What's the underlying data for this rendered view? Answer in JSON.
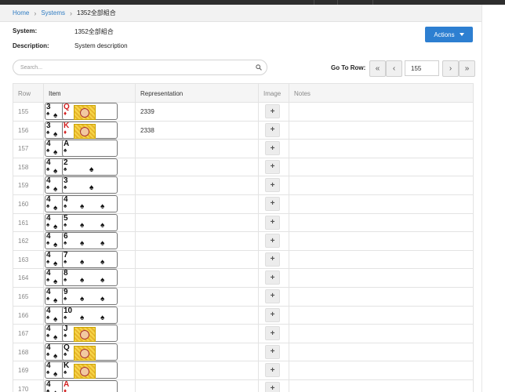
{
  "breadcrumb": {
    "home": "Home",
    "systems": "Systems",
    "current": "1352全部組合"
  },
  "meta": {
    "system_label": "System:",
    "system_value": "1352全部組合",
    "description_label": "Description:",
    "description_value": "System description"
  },
  "actions_label": "Actions",
  "search": {
    "placeholder": "Search..."
  },
  "goto": {
    "label": "Go To Row:",
    "value": "155"
  },
  "table": {
    "headers": {
      "row": "Row",
      "item": "Item",
      "representation": "Representation",
      "image": "Image",
      "notes": "Notes"
    }
  },
  "rows": [
    {
      "row": "155",
      "representation": "2339",
      "cards": [
        {
          "rank": "3",
          "suit": "♠"
        },
        {
          "rank": "Q",
          "suit": "♦",
          "face": true
        }
      ]
    },
    {
      "row": "156",
      "representation": "2338",
      "cards": [
        {
          "rank": "3",
          "suit": "♠"
        },
        {
          "rank": "K",
          "suit": "♦",
          "face": true
        }
      ]
    },
    {
      "row": "157",
      "representation": "",
      "cards": [
        {
          "rank": "4",
          "suit": "♠"
        },
        {
          "rank": "A",
          "suit": "♠"
        }
      ]
    },
    {
      "row": "158",
      "representation": "",
      "cards": [
        {
          "rank": "4",
          "suit": "♠"
        },
        {
          "rank": "2",
          "suit": "♠"
        }
      ]
    },
    {
      "row": "159",
      "representation": "",
      "cards": [
        {
          "rank": "4",
          "suit": "♠"
        },
        {
          "rank": "3",
          "suit": "♠"
        }
      ]
    },
    {
      "row": "160",
      "representation": "",
      "cards": [
        {
          "rank": "4",
          "suit": "♠"
        },
        {
          "rank": "4",
          "suit": "♠"
        }
      ]
    },
    {
      "row": "161",
      "representation": "",
      "cards": [
        {
          "rank": "4",
          "suit": "♠"
        },
        {
          "rank": "5",
          "suit": "♠"
        }
      ]
    },
    {
      "row": "162",
      "representation": "",
      "cards": [
        {
          "rank": "4",
          "suit": "♠"
        },
        {
          "rank": "6",
          "suit": "♠"
        }
      ]
    },
    {
      "row": "163",
      "representation": "",
      "cards": [
        {
          "rank": "4",
          "suit": "♠"
        },
        {
          "rank": "7",
          "suit": "♠"
        }
      ]
    },
    {
      "row": "164",
      "representation": "",
      "cards": [
        {
          "rank": "4",
          "suit": "♠"
        },
        {
          "rank": "8",
          "suit": "♠"
        }
      ]
    },
    {
      "row": "165",
      "representation": "",
      "cards": [
        {
          "rank": "4",
          "suit": "♠"
        },
        {
          "rank": "9",
          "suit": "♠"
        }
      ]
    },
    {
      "row": "166",
      "representation": "",
      "cards": [
        {
          "rank": "4",
          "suit": "♠"
        },
        {
          "rank": "10",
          "suit": "♠"
        }
      ]
    },
    {
      "row": "167",
      "representation": "",
      "cards": [
        {
          "rank": "4",
          "suit": "♠"
        },
        {
          "rank": "J",
          "suit": "♠",
          "face": true
        }
      ]
    },
    {
      "row": "168",
      "representation": "",
      "cards": [
        {
          "rank": "4",
          "suit": "♠"
        },
        {
          "rank": "Q",
          "suit": "♠",
          "face": true
        }
      ]
    },
    {
      "row": "169",
      "representation": "",
      "cards": [
        {
          "rank": "4",
          "suit": "♠"
        },
        {
          "rank": "K",
          "suit": "♠",
          "face": true
        }
      ]
    },
    {
      "row": "170",
      "representation": "",
      "cards": [
        {
          "rank": "4",
          "suit": "♠"
        },
        {
          "rank": "A",
          "suit": "♦"
        }
      ]
    }
  ],
  "icons": {
    "breadcrumb_separator": "chevron-right-icon",
    "actions_caret": "caret-down-icon",
    "search": "search-icon",
    "first": "double-chevron-left-icon",
    "prev": "chevron-left-icon",
    "next": "chevron-right-icon",
    "last": "double-chevron-right-icon",
    "add_image": "plus-icon"
  },
  "colors": {
    "accent": "#2d7fd1",
    "link": "#2f7cc2",
    "suit_red": "#d42020"
  }
}
